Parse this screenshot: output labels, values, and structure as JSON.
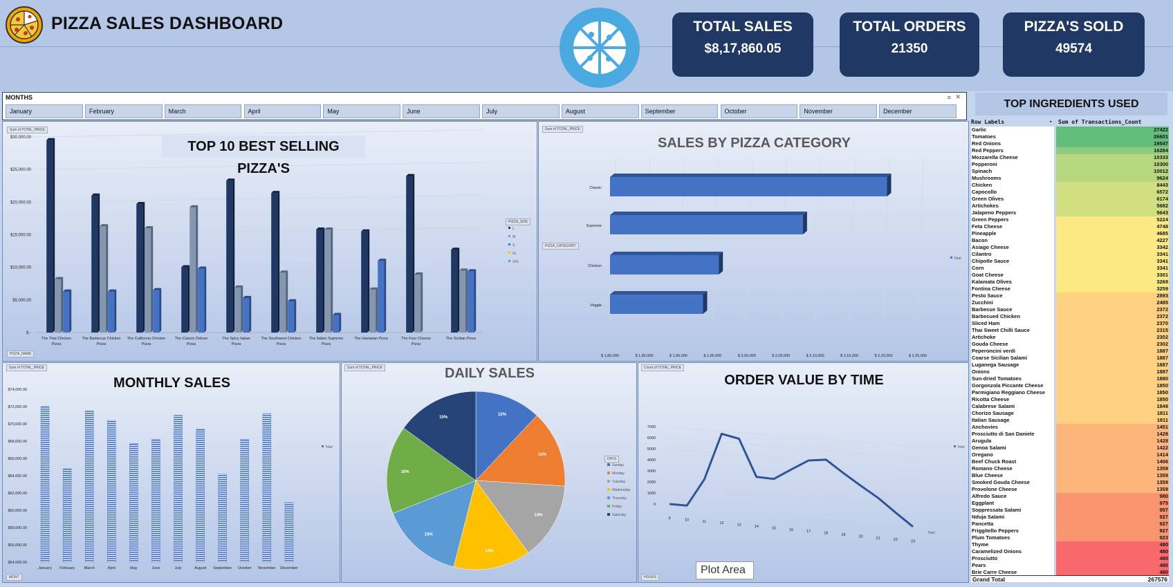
{
  "header": {
    "title": "PIZZA SALES DASHBOARD"
  },
  "kpis": [
    {
      "label": "TOTAL SALES",
      "value": "$8,17,860.05"
    },
    {
      "label": "TOTAL ORDERS",
      "value": "21350"
    },
    {
      "label": "PIZZA'S SOLD",
      "value": "49574"
    }
  ],
  "slicer": {
    "title": "MONTHS",
    "months": [
      "January",
      "February",
      "March",
      "April",
      "May",
      "June",
      "July",
      "August",
      "September",
      "October",
      "November",
      "December"
    ]
  },
  "ingredients": {
    "title": "TOP INGREDIENTS USED",
    "col_labels": "Row Labels",
    "col_values": "Sum of Transactions_Count",
    "rows": [
      [
        "Garlic",
        27422
      ],
      [
        "Tomatoes",
        26601
      ],
      [
        "Red Onions",
        19547
      ],
      [
        "Red Peppers",
        16284
      ],
      [
        "Mozzarella Cheese",
        10333
      ],
      [
        "Pepperoni",
        10300
      ],
      [
        "Spinach",
        10012
      ],
      [
        "Mushrooms",
        9624
      ],
      [
        "Chicken",
        8443
      ],
      [
        "Capocollo",
        6572
      ],
      [
        "Green Olives",
        6174
      ],
      [
        "Artichokes",
        5682
      ],
      [
        "Jalapeno Peppers",
        5643
      ],
      [
        "Green Peppers",
        5224
      ],
      [
        "Feta Cheese",
        4748
      ],
      [
        "Pineapple",
        4685
      ],
      [
        "Bacon",
        4227
      ],
      [
        "Asiago Cheese",
        3342
      ],
      [
        "Cilantro",
        3341
      ],
      [
        "Chipotle Sauce",
        3341
      ],
      [
        "Corn",
        3341
      ],
      [
        "Goat Cheese",
        3301
      ],
      [
        "Kalamata Olives",
        3269
      ],
      [
        "Fontina Cheese",
        3259
      ],
      [
        "Pesto Sauce",
        2893
      ],
      [
        "Zucchini",
        2485
      ],
      [
        "Barbecue Sauce",
        2372
      ],
      [
        "Barbecued Chicken",
        2372
      ],
      [
        "Sliced Ham",
        2370
      ],
      [
        "Thai Sweet Chilli Sauce",
        2315
      ],
      [
        "Artichoke",
        2302
      ],
      [
        "Gouda Cheese",
        2302
      ],
      [
        "Peperoncini verdi",
        1887
      ],
      [
        "Coarse Sicilian Salami",
        1887
      ],
      [
        "Luganega Sausage",
        1887
      ],
      [
        "Onions",
        1887
      ],
      [
        "Sun-dried Tomatoes",
        1880
      ],
      [
        "Gorgonzola Piccante Cheese",
        1850
      ],
      [
        "Parmigiano Reggiano Cheese",
        1850
      ],
      [
        "Ricotta Cheese",
        1850
      ],
      [
        "Calabrese Salami",
        1849
      ],
      [
        "Chorizo Sausage",
        1811
      ],
      [
        "Italian Sausage",
        1811
      ],
      [
        "Anchovies",
        1451
      ],
      [
        "Prosciutto di San Daniele",
        1428
      ],
      [
        "Arugula",
        1428
      ],
      [
        "Genoa Salami",
        1422
      ],
      [
        "Oregano",
        1414
      ],
      [
        "Beef Chuck Roast",
        1406
      ],
      [
        "Romano Cheese",
        1359
      ],
      [
        "Blue Cheese",
        1359
      ],
      [
        "Smoked Gouda Cheese",
        1359
      ],
      [
        "Provolone Cheese",
        1359
      ],
      [
        "Alfredo Sauce",
        980
      ],
      [
        "Eggplant",
        975
      ],
      [
        "Soppressata Salami",
        957
      ],
      [
        "Nduja Salami",
        927
      ],
      [
        "Pancetta",
        927
      ],
      [
        "Friggitello Peppers",
        927
      ],
      [
        "Plum Tomatoes",
        923
      ],
      [
        "Thyme",
        480
      ],
      [
        "Caramelized Onions",
        480
      ],
      [
        "Prosciutto",
        480
      ],
      [
        "Pears",
        480
      ],
      [
        "Brie Carre Cheese",
        480
      ]
    ],
    "grand_label": "Grand Total",
    "grand_value": "267576"
  },
  "tooltip": "Plot Area",
  "icons": {
    "logo": "pizza-logo-icon",
    "center": "pizza-slice-icon"
  },
  "colors": {
    "navy": "#1f3864",
    "blue": "#4472c4",
    "gray": "#8497b0",
    "background": "#c7d6ef"
  },
  "charts": {
    "top10": {
      "pill": "Sum of TOTAL_PRICE",
      "pill_bottom": "PIZZA_NAME",
      "legend_title": "PIZZA_SIZE",
      "title": "TOP 10 BEST SELLING PIZZA'S"
    },
    "category": {
      "pill": "Sum of TOTAL_PRICE",
      "pill_side": "PIZZA_CATEGORY",
      "title": "SALES BY PIZZA CATEGORY"
    },
    "monthly": {
      "pill": "Sum of TOTAL_PRICE",
      "pill_bottom": "MONT",
      "title": "MONTHLY SALES"
    },
    "daily": {
      "pill": "Sum of TOTAL_PRICE",
      "legend_title": "DAYS",
      "title": "DAILY SALES"
    },
    "hourly": {
      "pill": "Count of TOTAL_PRICE",
      "pill_bottom": "HOURS",
      "title": "ORDER VALUE BY TIME"
    }
  },
  "chart_data": [
    {
      "type": "bar",
      "title": "TOP 10 BEST SELLING PIZZA'S",
      "categories": [
        "The Thai Chicken Pizza",
        "The Barbecue Chicken Pizza",
        "The California Chicken Pizza",
        "The Classic Deluxe Pizza",
        "The Spicy Italian Pizza",
        "The Southwest Chicken Pizza",
        "The Italian Supreme Pizza",
        "The Hawaiian Pizza",
        "The Four Cheese Pizza",
        "The Sicilian Pizza"
      ],
      "series": [
        {
          "name": "L",
          "values": [
            29500,
            21000,
            19700,
            10000,
            23300,
            21400,
            15800,
            15500,
            24000,
            12700
          ]
        },
        {
          "name": "M",
          "values": [
            8200,
            16300,
            16000,
            19200,
            6900,
            9200,
            15800,
            6600,
            8900,
            9500
          ]
        },
        {
          "name": "S",
          "values": [
            6300,
            6300,
            6500,
            9800,
            5300,
            4800,
            2700,
            11000,
            null,
            9400
          ]
        },
        {
          "name": "XL",
          "values": [
            null,
            null,
            null,
            null,
            null,
            null,
            null,
            null,
            null,
            null
          ]
        },
        {
          "name": "XXL",
          "values": [
            null,
            null,
            null,
            null,
            null,
            null,
            null,
            null,
            null,
            null
          ]
        }
      ],
      "ylim": [
        0,
        30000
      ],
      "yticks": [
        "$ -",
        "$5,000.00",
        "$10,000.00",
        "$15,000.00",
        "$20,000.00",
        "$25,000.00",
        "$30,000.00"
      ],
      "legend": "right"
    },
    {
      "type": "bar",
      "orientation": "horizontal",
      "title": "SALES BY PIZZA CATEGORY",
      "categories": [
        "Classic",
        "Supreme",
        "Chicken",
        "Veggie"
      ],
      "series": [
        {
          "name": "Total",
          "values": [
            220500,
            208200,
            195900,
            193600
          ]
        }
      ],
      "xlim": [
        180000,
        225000
      ],
      "xticks": [
        "$ 1,80,000",
        "$ 1,85,000",
        "$ 1,90,000",
        "$ 1,95,000",
        "$ 2,00,000",
        "$ 2,05,000",
        "$ 2,10,000",
        "$ 2,15,000",
        "$ 2,20,000",
        "$ 2,25,000"
      ],
      "legend": "right"
    },
    {
      "type": "bar",
      "title": "MONTHLY SALES",
      "categories": [
        "January",
        "February",
        "March",
        "April",
        "May",
        "June",
        "July",
        "August",
        "September",
        "October",
        "November",
        "December"
      ],
      "series": [
        {
          "name": "Total",
          "values": [
            72000,
            64800,
            71500,
            70400,
            67700,
            68200,
            71000,
            69400,
            64200,
            68200,
            71200,
            60900
          ]
        }
      ],
      "ylim": [
        54000,
        74000
      ],
      "yticks": [
        "$54,000.00",
        "$56,000.00",
        "$58,000.00",
        "$60,000.00",
        "$62,000.00",
        "$64,000.00",
        "$66,000.00",
        "$68,000.00",
        "$70,000.00",
        "$72,000.00",
        "$74,000.00"
      ],
      "legend": "right"
    },
    {
      "type": "pie",
      "title": "DAILY SALES",
      "labels": [
        "Sunday",
        "Monday",
        "Tuesday",
        "Wednesday",
        "Thursday",
        "Friday",
        "Saturday"
      ],
      "values": [
        12,
        14,
        14,
        14,
        15,
        16,
        15
      ],
      "data_labels": [
        "12%",
        "14%",
        "14%",
        "14%",
        "15%",
        "16%",
        "15%"
      ],
      "colors": [
        "#4472c4",
        "#ed7d31",
        "#a5a5a5",
        "#ffc000",
        "#5b9bd5",
        "#70ad47",
        "#264478"
      ],
      "legend": "right"
    },
    {
      "type": "line",
      "title": "ORDER VALUE BY TIME",
      "x": [
        9,
        10,
        11,
        12,
        13,
        14,
        15,
        16,
        17,
        18,
        19,
        20,
        21,
        22,
        23
      ],
      "series": [
        {
          "name": "Total",
          "values": [
            1,
            8,
            2520,
            6800,
            6500,
            3200,
            3170,
            4170,
            5140,
            5360,
            4300,
            3300,
            2350,
            1180,
            50
          ]
        }
      ],
      "ylim": [
        0,
        7000
      ],
      "yticks": [
        "0",
        "1000",
        "2000",
        "3000",
        "4000",
        "5000",
        "6000",
        "7000"
      ],
      "legend": "right"
    }
  ]
}
